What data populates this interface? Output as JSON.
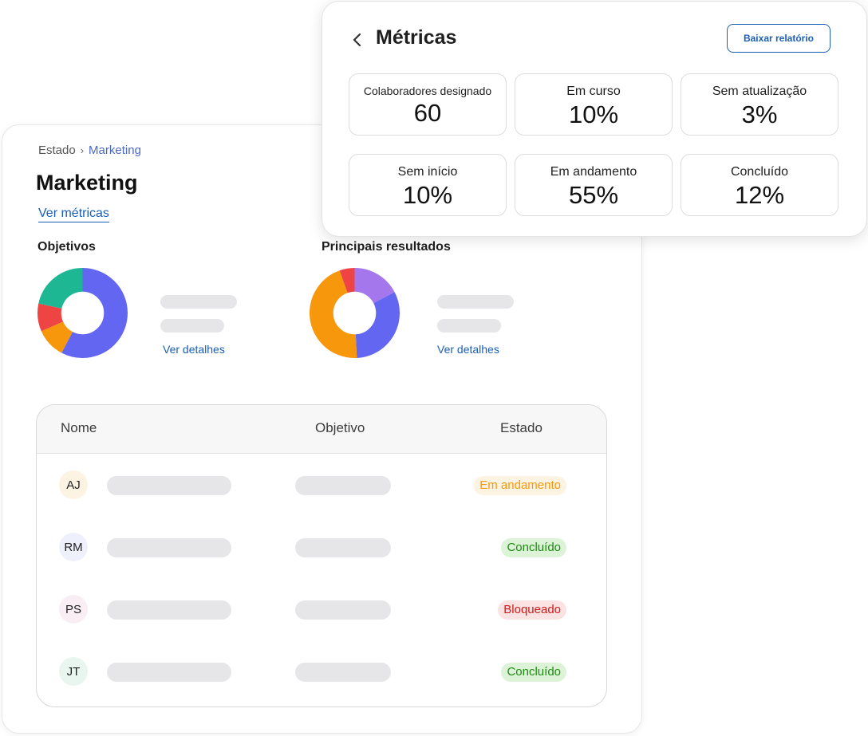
{
  "breadcrumb": {
    "root": "Estado",
    "separator": "›",
    "current": "Marketing"
  },
  "page": {
    "title": "Marketing",
    "metrics_link": "Ver métricas"
  },
  "objectives": {
    "title": "Objetivos",
    "details_link": "Ver detalhes"
  },
  "key_results": {
    "title": "Principais resultados",
    "details_link": "Ver detalhes"
  },
  "colors": {
    "purple_blue": "#6366f1",
    "orange": "#f7970b",
    "red": "#ef4444",
    "teal": "#1db893",
    "lavender": "#a478ec",
    "link_blue": "#1a5fb4"
  },
  "table": {
    "headers": {
      "name": "Nome",
      "objective": "Objetivo",
      "status": "Estado"
    },
    "rows": [
      {
        "initials": "AJ",
        "status": "Em andamento",
        "status_color": "#f7970b",
        "status_bg": "#fdf3e2",
        "avatar_bg": "#fdf3e2"
      },
      {
        "initials": "RM",
        "status": "Concluído",
        "status_color": "#1f8a12",
        "status_bg": "#dcf3d8",
        "avatar_bg": "#eef0fb"
      },
      {
        "initials": "PS",
        "status": "Bloqueado",
        "status_color": "#d11a1a",
        "status_bg": "#fbe3e3",
        "avatar_bg": "#f8eef4"
      },
      {
        "initials": "JT",
        "status": "Concluído",
        "status_color": "#1f8a12",
        "status_bg": "#dcf3d8",
        "avatar_bg": "#e8f6ef"
      }
    ]
  },
  "metrics": {
    "title": "Métricas",
    "back_icon": "chevron-left-icon",
    "download_label": "Baixar relatório",
    "cards": [
      {
        "label": "Colaboradores designado",
        "value": "60"
      },
      {
        "label": "Em curso",
        "value": "10%"
      },
      {
        "label": "Sem atualização",
        "value": "3%"
      },
      {
        "label": "Sem início",
        "value": "10%"
      },
      {
        "label": "Em andamento",
        "value": "55%"
      },
      {
        "label": "Concluído",
        "value": "12%"
      }
    ]
  }
}
